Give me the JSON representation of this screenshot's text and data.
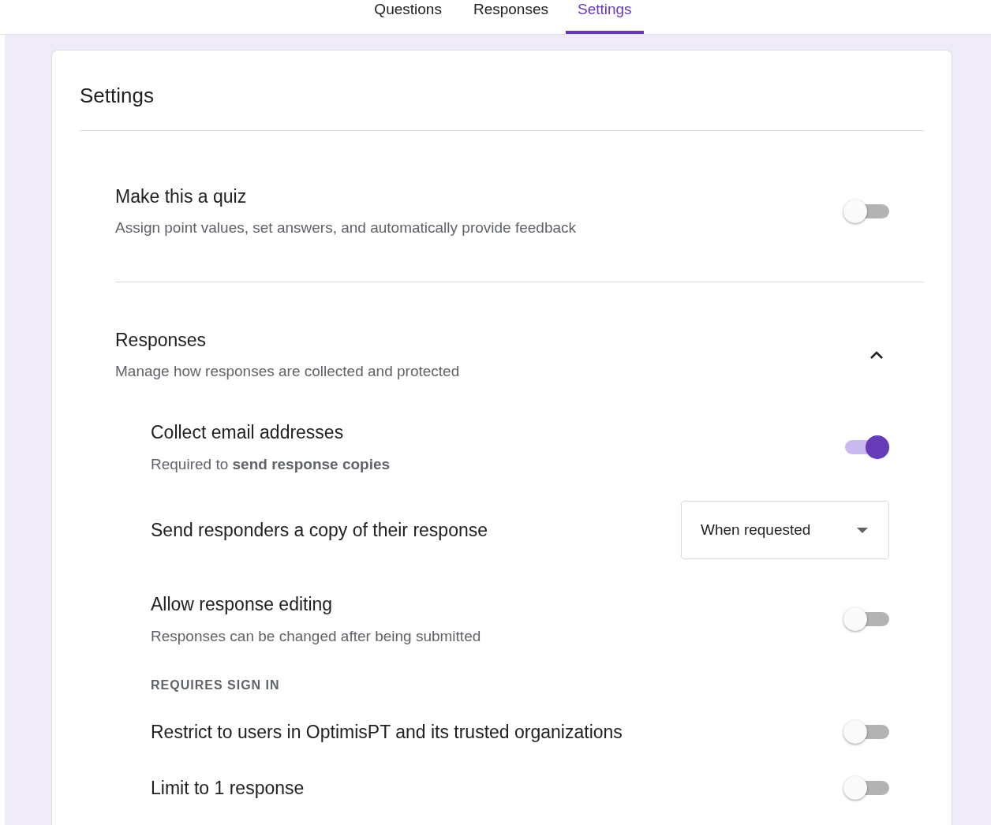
{
  "tabs": [
    {
      "label": "Questions",
      "selected": false
    },
    {
      "label": "Responses",
      "selected": false
    },
    {
      "label": "Settings",
      "selected": true
    }
  ],
  "title": "Settings",
  "quiz": {
    "title": "Make this a quiz",
    "description": "Assign point values, set answers, and automatically provide feedback",
    "on": false
  },
  "responses": {
    "title": "Responses",
    "description": "Manage how responses are collected and protected",
    "expanded": true,
    "items": [
      {
        "kind": "toggle",
        "title": "Collect email addresses",
        "description": "Required to **send response copies**",
        "on": true
      },
      {
        "kind": "select",
        "title": "Send responders a copy of their response",
        "value": "When requested"
      },
      {
        "kind": "toggle",
        "title": "Allow response editing",
        "description": "Responses can be changed after being submitted",
        "on": false
      },
      {
        "kind": "heading",
        "label": "REQUIRES SIGN IN"
      },
      {
        "kind": "toggle",
        "title": "Restrict to users in OptimisPT and its trusted organizations",
        "on": false
      },
      {
        "kind": "toggle",
        "title": "Limit to 1 response",
        "on": false
      }
    ]
  }
}
